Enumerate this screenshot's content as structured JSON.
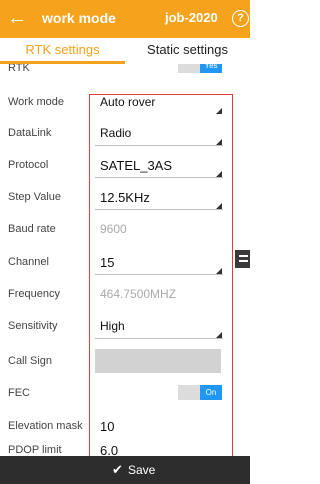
{
  "header": {
    "back_icon": "arrow-left-icon",
    "title": "work mode",
    "job": "job-2020",
    "help_icon": "help-circle-icon",
    "help_symbol": "?",
    "accent_color": "#f5a21c"
  },
  "tabs": [
    {
      "label": "RTK settings",
      "active": true
    },
    {
      "label": "Static settings",
      "active": false
    }
  ],
  "fields": {
    "rtk": {
      "label": "RTK",
      "value": "Yes"
    },
    "work_mode": {
      "label": "Work mode",
      "value": "Auto rover"
    },
    "datalink": {
      "label": "DataLink",
      "value": "Radio"
    },
    "protocol": {
      "label": "Protocol",
      "value": "SATEL_3AS"
    },
    "step_value": {
      "label": "Step Value",
      "value": "12.5KHz"
    },
    "baud_rate": {
      "label": "Baud rate",
      "placeholder": "9600"
    },
    "channel": {
      "label": "Channel",
      "value": "15"
    },
    "frequency": {
      "label": "Frequency",
      "placeholder": "464.7500MHZ"
    },
    "sensitivity": {
      "label": "Sensitivity",
      "value": "High"
    },
    "call_sign": {
      "label": "Call Sign",
      "value": ""
    },
    "fec": {
      "label": "FEC",
      "value": "On"
    },
    "elevation_mask": {
      "label": "Elevation mask",
      "value": "10"
    },
    "pdop_limit": {
      "label": "PDOP limit",
      "value": "6.0"
    }
  },
  "footer": {
    "save_icon": "check-icon",
    "save_label": "Save"
  },
  "toggle_color": "#2196f3",
  "highlight_color": "#e23b3b"
}
